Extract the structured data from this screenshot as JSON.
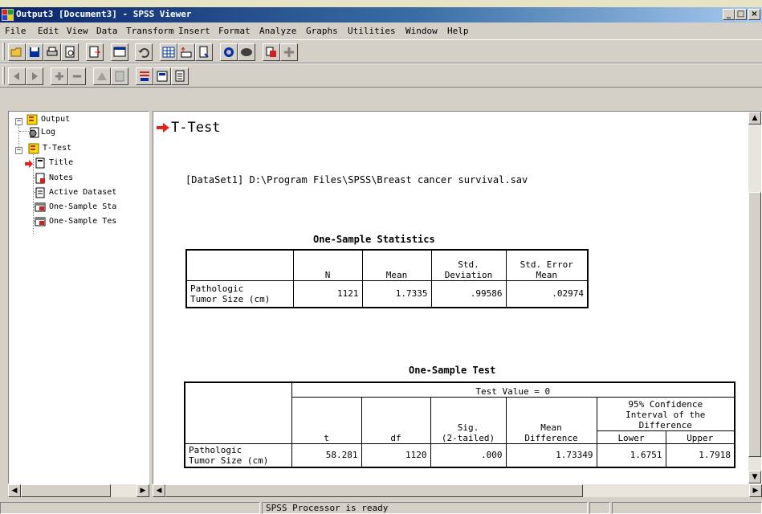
{
  "window": {
    "title": "Output3 [Document3] - SPSS Viewer",
    "controls": [
      "_",
      "□",
      "×"
    ]
  },
  "menu": [
    "File",
    "Edit",
    "View",
    "Data",
    "Transform",
    "Insert",
    "Format",
    "Analyze",
    "Graphs",
    "Utilities",
    "Window",
    "Help"
  ],
  "outline": {
    "nodes": [
      {
        "label": "Output",
        "icon": "output-book-icon"
      },
      {
        "label": "Log",
        "icon": "log-icon"
      },
      {
        "label": "T-Test",
        "icon": "ttest-book-icon"
      },
      {
        "label": "Title",
        "icon": "title-icon"
      },
      {
        "label": "Notes",
        "icon": "notes-icon"
      },
      {
        "label": "Active Dataset",
        "icon": "dataset-icon"
      },
      {
        "label": "One-Sample Sta",
        "icon": "table-icon"
      },
      {
        "label": "One-Sample Tes",
        "icon": "table-icon"
      }
    ]
  },
  "content": {
    "heading": "T-Test",
    "dataset_line": "[DataSet1] D:\\Program Files\\SPSS\\Breast cancer survival.sav",
    "stats_table": {
      "caption": "One-Sample Statistics",
      "headers": [
        "",
        "N",
        "Mean",
        "Std. Deviation",
        "Std. Error Mean"
      ],
      "header_lines": {
        "std_dev_1": "Std.",
        "std_dev_2": "Deviation",
        "se_1": "Std. Error",
        "se_2": "Mean"
      },
      "row": {
        "label_1": "Pathologic",
        "label_2": "Tumor Size (cm)",
        "n": "1121",
        "mean": "1.7335",
        "std_dev": ".99586",
        "se_mean": ".02974"
      }
    },
    "test_table": {
      "caption": "One-Sample Test",
      "test_value": "Test Value = 0",
      "ci_header_1": "95% Confidence",
      "ci_header_2": "Interval of the",
      "ci_header_3": "Difference",
      "headers": {
        "t": "t",
        "df": "df",
        "sig_1": "Sig.",
        "sig_2": "(2-tailed)",
        "md_1": "Mean",
        "md_2": "Difference",
        "lower": "Lower",
        "upper": "Upper"
      },
      "row": {
        "label_1": "Pathologic",
        "label_2": "Tumor Size (cm)",
        "t": "58.281",
        "df": "1120",
        "sig": ".000",
        "mean_diff": "1.73349",
        "lower": "1.6751",
        "upper": "1.7918"
      }
    }
  },
  "status": {
    "text": "SPSS Processor is ready"
  },
  "colors": {
    "titlebar": "#0a246a",
    "arrow": "#e8201a",
    "window": "#d4d0c8"
  }
}
